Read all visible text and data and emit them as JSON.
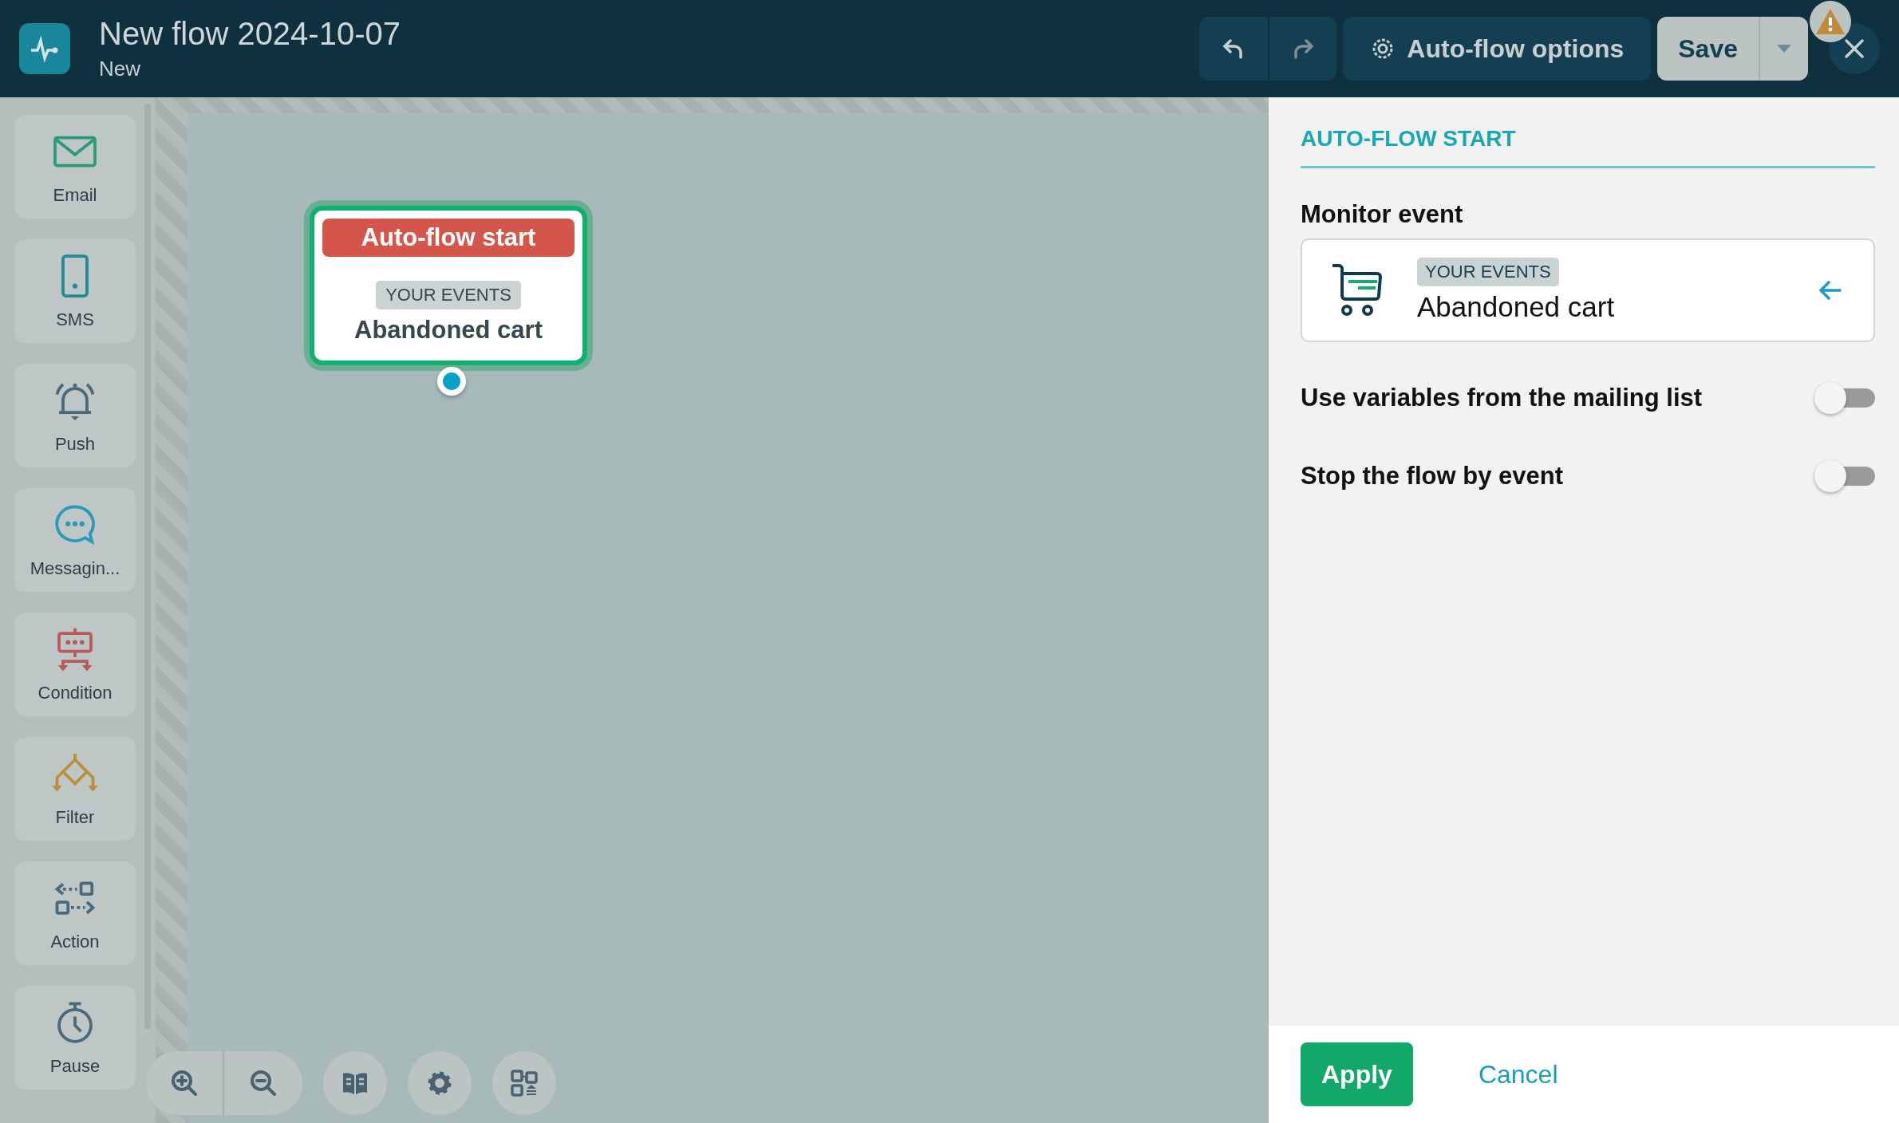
{
  "header": {
    "title": "New flow 2024-10-07",
    "status": "New",
    "options_button": "Auto-flow options",
    "save_button": "Save",
    "warning": true
  },
  "palette": [
    {
      "kind": "email",
      "label": "Email"
    },
    {
      "kind": "sms",
      "label": "SMS"
    },
    {
      "kind": "push",
      "label": "Push"
    },
    {
      "kind": "messaging",
      "label": "Messagin..."
    },
    {
      "kind": "condition",
      "label": "Condition"
    },
    {
      "kind": "filter",
      "label": "Filter"
    },
    {
      "kind": "action",
      "label": "Action"
    },
    {
      "kind": "pause",
      "label": "Pause"
    }
  ],
  "canvas": {
    "node": {
      "title": "Auto-flow start",
      "tag": "YOUR EVENTS",
      "event": "Abandoned cart",
      "selected": true
    }
  },
  "panel": {
    "heading": "AUTO-FLOW START",
    "monitor_label": "Monitor event",
    "event_tag": "YOUR EVENTS",
    "event_name": "Abandoned cart",
    "toggles": [
      {
        "label": "Use variables from the mailing list",
        "on": false
      },
      {
        "label": "Stop the flow by event",
        "on": false
      }
    ],
    "apply": "Apply",
    "cancel": "Cancel"
  }
}
